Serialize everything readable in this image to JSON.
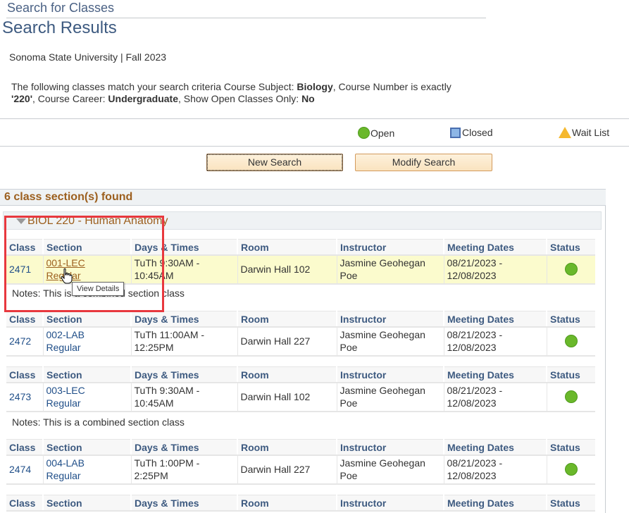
{
  "breadcrumb": "Search for Classes",
  "page_title": "Search Results",
  "institution_term": "Sonoma State University | Fall 2023",
  "criteria": {
    "prefix": "The following classes match your search criteria Course Subject: ",
    "subject": "Biology",
    "number_label": ",  Course Number is exactly",
    "number": "'220'",
    "career_label": ",  Course Career: ",
    "career": "Undergraduate",
    "open_label": ",  Show Open Classes Only: ",
    "open_only": "No"
  },
  "legend": {
    "open": "Open",
    "closed": "Closed",
    "wait_list": "Wait List"
  },
  "buttons": {
    "new_search": "New Search",
    "modify_search": "Modify Search"
  },
  "results_count": "6 class section(s) found",
  "course_title": "BIOL 220 - Human Anatomy",
  "table_headers": {
    "class": "Class",
    "section": "Section",
    "days_times": "Days & Times",
    "room": "Room",
    "instructor": "Instructor",
    "meeting_dates": "Meeting Dates",
    "status": "Status"
  },
  "sections": [
    {
      "class_nbr": "2471",
      "section": "001-LEC",
      "section_type": "Regular",
      "days_times_1": "TuTh 9:30AM -",
      "days_times_2": "10:45AM",
      "room": "Darwin Hall 102",
      "instructor_1": "Jasmine Geohegan",
      "instructor_2": "Poe",
      "dates_1": "08/21/2023 -",
      "dates_2": "12/08/2023",
      "status": "Open",
      "notes": "Notes: This is a combined section class"
    },
    {
      "class_nbr": "2472",
      "section": "002-LAB",
      "section_type": "Regular",
      "days_times_1": "TuTh 11:00AM -",
      "days_times_2": "12:25PM",
      "room": "Darwin Hall 227",
      "instructor_1": "Jasmine Geohegan",
      "instructor_2": "Poe",
      "dates_1": "08/21/2023 -",
      "dates_2": "12/08/2023",
      "status": "Open"
    },
    {
      "class_nbr": "2473",
      "section": "003-LEC",
      "section_type": "Regular",
      "days_times_1": "TuTh 9:30AM -",
      "days_times_2": "10:45AM",
      "room": "Darwin Hall 102",
      "instructor_1": "Jasmine Geohegan",
      "instructor_2": "Poe",
      "dates_1": "08/21/2023 -",
      "dates_2": "12/08/2023",
      "status": "Open",
      "notes": "Notes: This is a combined section class"
    },
    {
      "class_nbr": "2474",
      "section": "004-LAB",
      "section_type": "Regular",
      "days_times_1": "TuTh 1:00PM -",
      "days_times_2": "2:25PM",
      "room": "Darwin Hall 227",
      "instructor_1": "Jasmine Geohegan",
      "instructor_2": "Poe",
      "dates_1": "08/21/2023 -",
      "dates_2": "12/08/2023",
      "status": "Open"
    }
  ],
  "tooltip": "View Details",
  "colors": {
    "open": "#6ab82b",
    "closed": "#8db6e6",
    "wait_list": "#f5b82e",
    "highlight_row": "#fbfbcd",
    "annotation_box": "#e8383e"
  }
}
